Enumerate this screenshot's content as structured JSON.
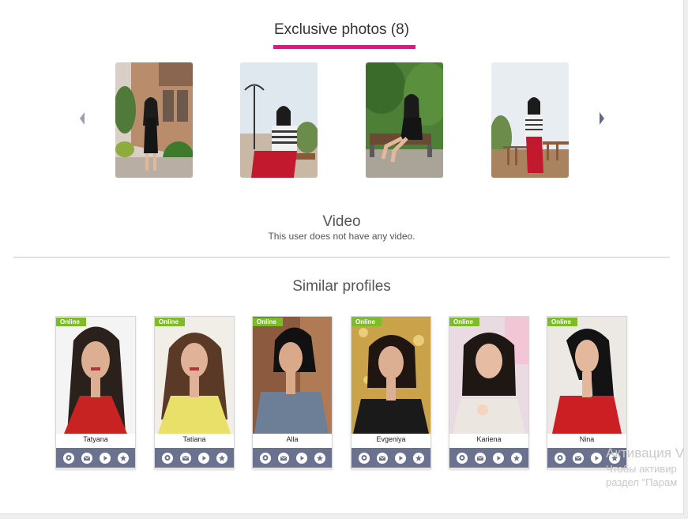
{
  "exclusive": {
    "title": "Exclusive photos (8)",
    "accent_color": "#e8118c",
    "photos": [
      {
        "name": "exclusive-photo-1"
      },
      {
        "name": "exclusive-photo-2"
      },
      {
        "name": "exclusive-photo-3"
      },
      {
        "name": "exclusive-photo-4"
      }
    ],
    "prev_icon": "chevron-left-icon",
    "next_icon": "chevron-right-icon"
  },
  "video": {
    "title": "Video",
    "note": "This user does not have any video."
  },
  "similar": {
    "title": "Similar profiles",
    "badge_color": "#7dbb2b",
    "action_bar_color": "#6a7290",
    "profiles": [
      {
        "name": "Tatyana",
        "status": "Online"
      },
      {
        "name": "Tatiana",
        "status": "Online"
      },
      {
        "name": "Alla",
        "status": "Online"
      },
      {
        "name": "Evgeniya",
        "status": "Online"
      },
      {
        "name": "Kariena",
        "status": "Online"
      },
      {
        "name": "Nina",
        "status": "Online"
      }
    ],
    "action_icons": [
      "webcam-icon",
      "mail-icon",
      "play-icon",
      "star-icon"
    ]
  },
  "watermark": {
    "line1": "Активация V",
    "line2": "Чтобы активир",
    "line3": "раздел \"Парам"
  }
}
